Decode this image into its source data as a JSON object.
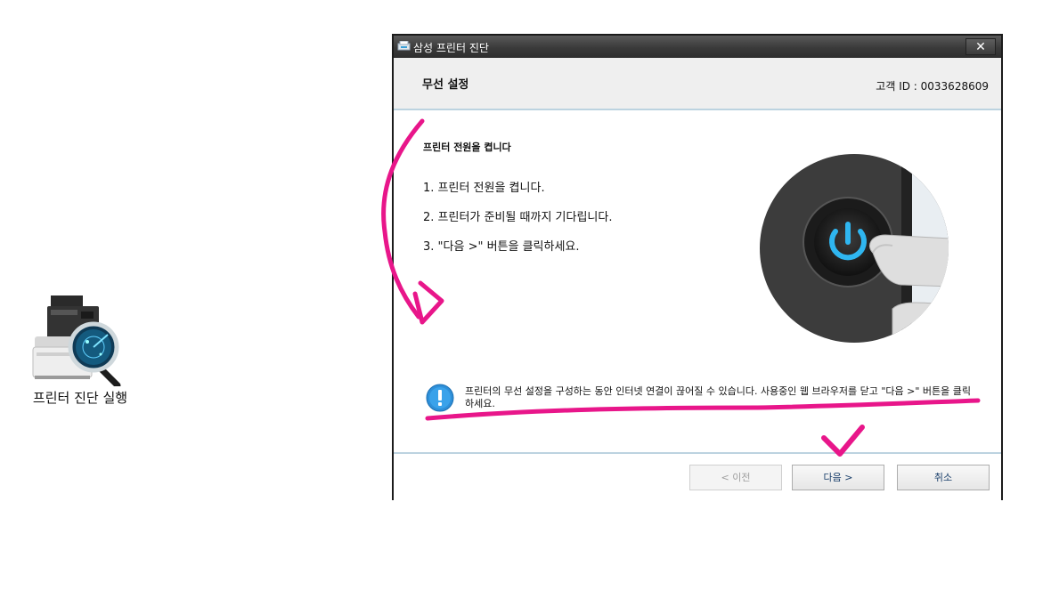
{
  "desktop": {
    "shortcut_label": "프린터 진단 실행"
  },
  "window": {
    "title": "삼성 프린터 진단",
    "close_glyph": "✕",
    "header": {
      "title": "무선 설정",
      "customer_id": "고객 ID : 0033628609"
    },
    "content": {
      "step_title": "프린터 전원을 켭니다",
      "steps": [
        "1. 프린터 전원을 켭니다.",
        "2. 프린터가 준비될 때까지 기다립니다.",
        "3. \"다음 >\" 버튼을 클릭하세요."
      ],
      "note": "프린터의 무선 설정을 구성하는 동안 인터넷 연결이 끊어질 수 있습니다. 사용중인 웹 브라우저를 닫고 \"다음 >\" 버튼을 클릭하세요.",
      "note_icon": "info-icon"
    },
    "footer": {
      "prev_label": "< 이전",
      "next_label": "다음 >",
      "cancel_label": "취소"
    }
  },
  "colors": {
    "annotation": "#e8168a",
    "titlebar": "#3a3a3a",
    "header_bg": "#efefef",
    "divider": "#bcd3e0",
    "power_glow": "#2fb6f0"
  }
}
